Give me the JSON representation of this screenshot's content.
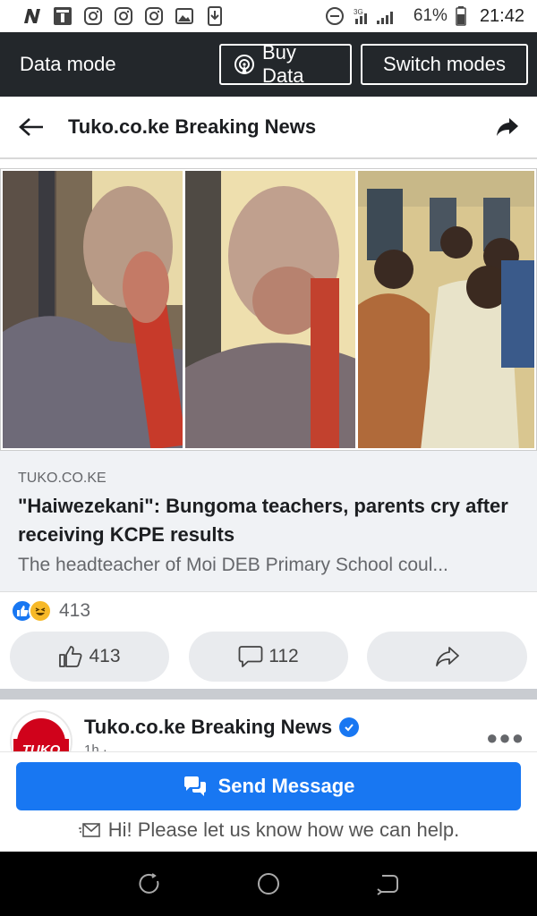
{
  "status_bar": {
    "battery": "61%",
    "time": "21:42",
    "network": "3G",
    "icons": [
      "n-app-icon",
      "news-icon",
      "instagram-icon",
      "instagram-icon",
      "instagram-icon",
      "gallery-icon",
      "download-icon",
      "minus-circle-icon",
      "signal-icon",
      "battery-icon"
    ]
  },
  "data_bar": {
    "title": "Data mode",
    "buy_data": "Buy Data",
    "switch_modes": "Switch modes"
  },
  "header": {
    "title": "Tuko.co.ke Breaking News"
  },
  "link_preview": {
    "source": "TUKO.CO.KE",
    "headline": "\"Haiwezekani\": Bungoma teachers, parents cry after receiving KCPE results",
    "description": "The headteacher of Moi DEB Primary School coul..."
  },
  "reactions": {
    "count": "413"
  },
  "actions": {
    "like_count": "413",
    "comment_count": "112"
  },
  "next_post": {
    "page_name": "Tuko.co.ke Breaking News",
    "meta": "1h ·",
    "avatar_text": "TUKO"
  },
  "message": {
    "send_label": "Send Message",
    "help_text": "Hi! Please let us know how we can help."
  },
  "colors": {
    "fb_blue": "#1877f2",
    "data_bar_bg": "#23272b",
    "tuko_red": "#d0021b"
  }
}
